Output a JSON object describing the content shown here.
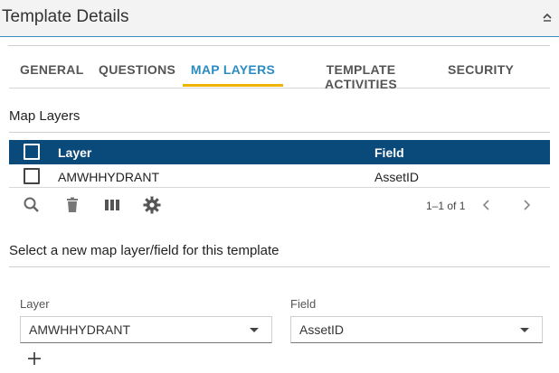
{
  "header": {
    "title": "Template Details",
    "collapse_icon": "chevron-up-icon"
  },
  "tabs": [
    {
      "label": "GENERAL",
      "active": false
    },
    {
      "label": "QUESTIONS",
      "active": false
    },
    {
      "label": "MAP LAYERS",
      "active": true
    },
    {
      "label": "TEMPLATE ACTIVITIES",
      "active": false
    },
    {
      "label": "SECURITY",
      "active": false
    }
  ],
  "map_layers": {
    "title": "Map Layers",
    "columns": {
      "layer": "Layer",
      "field": "Field"
    },
    "rows": [
      {
        "layer": "AMWHHYDRANT",
        "field": "AssetID",
        "checked": false
      }
    ],
    "toolbar": [
      "search-icon",
      "trash-icon",
      "columns-icon",
      "gear-icon"
    ],
    "pager": {
      "text": "1–1 of 1"
    }
  },
  "new_layer": {
    "title": "Select a new map layer/field for this template",
    "layer_label": "Layer",
    "layer_value": "AMWHHYDRANT",
    "field_label": "Field",
    "field_value": "AssetID"
  },
  "colors": {
    "header_bar": "#0a4a7a",
    "active_tab": "#2b8cc4",
    "tab_indicator": "#f0b400"
  }
}
